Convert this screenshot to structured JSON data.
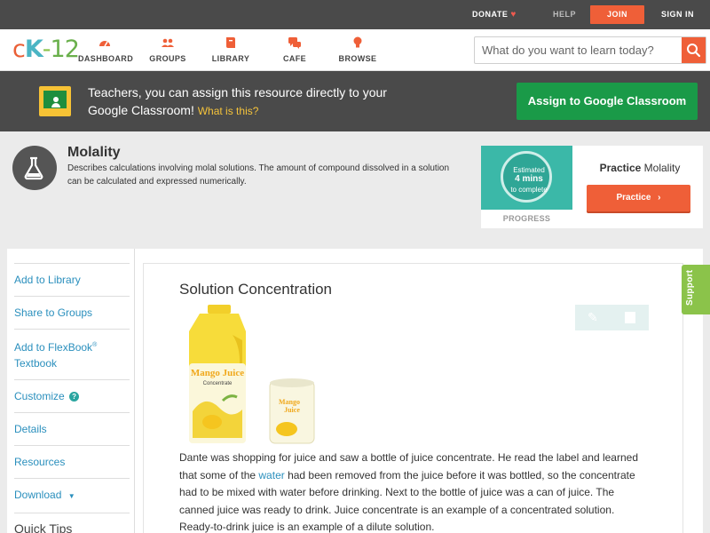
{
  "topbar": {
    "donate": "DONATE",
    "help": "HELP",
    "join": "JOIN",
    "sign_in": "SIGN IN"
  },
  "logo": {
    "c": "c",
    "k": "K",
    "dash": "-",
    "num": "12"
  },
  "nav": [
    {
      "label": "DASHBOARD",
      "icon": "dashboard-gauge-icon"
    },
    {
      "label": "GROUPS",
      "icon": "groups-people-icon"
    },
    {
      "label": "LIBRARY",
      "icon": "library-book-icon"
    },
    {
      "label": "CAFE",
      "icon": "cafe-chat-icon"
    },
    {
      "label": "BROWSE",
      "icon": "browse-bulb-icon"
    }
  ],
  "search": {
    "placeholder": "What do you want to learn today?",
    "icon": "search-icon"
  },
  "banner": {
    "message": "Teachers, you can assign this resource directly to your Google Classroom!",
    "link": "What is this?",
    "button": "Assign to Google Classroom"
  },
  "concept": {
    "title": "Molality",
    "description": "Describes calculations involving molal solutions. The amount of compound dissolved in a solution can be calculated and expressed numerically."
  },
  "practice": {
    "estimated_line1": "Estimated",
    "estimated_line2": "4 mins",
    "estimated_line3": "to complete",
    "progress_label": "PROGRESS",
    "title_bold": "Practice",
    "title_rest": "Molality",
    "button": "Practice"
  },
  "sidebar": {
    "items": [
      {
        "label": "Add to Library"
      },
      {
        "label": "Share to Groups"
      },
      {
        "label": "Add to FlexBook",
        "sup": "®",
        "label2": "Textbook"
      },
      {
        "label": "Customize"
      },
      {
        "label": "Details"
      },
      {
        "label": "Resources"
      },
      {
        "label": "Download"
      }
    ],
    "quick_tips": "Quick Tips"
  },
  "content": {
    "heading": "Solution Concentration",
    "jug_label": "Mango Juice",
    "jug_sub": "Concentrate",
    "can_label_1": "Mango",
    "can_label_2": "Juice",
    "para_part1": "Dante was shopping for juice and saw a bottle of juice concentrate. He read the label and learned that some of the ",
    "para_link": "water",
    "para_part2": " had been removed from the juice before it was bottled, so the concentrate had to be mixed with water before drinking. Next to the bottle of juice was a can of juice. The canned juice was ready to drink. Juice concentrate is an example of a concentrated solution. Ready-to-drink juice is an example of a dilute solution."
  },
  "support": "Support",
  "colors": {
    "accent_orange": "#ef5f38",
    "google_green": "#1a9a48",
    "link_blue": "#2a8fbd",
    "support_green": "#8bc34a"
  }
}
